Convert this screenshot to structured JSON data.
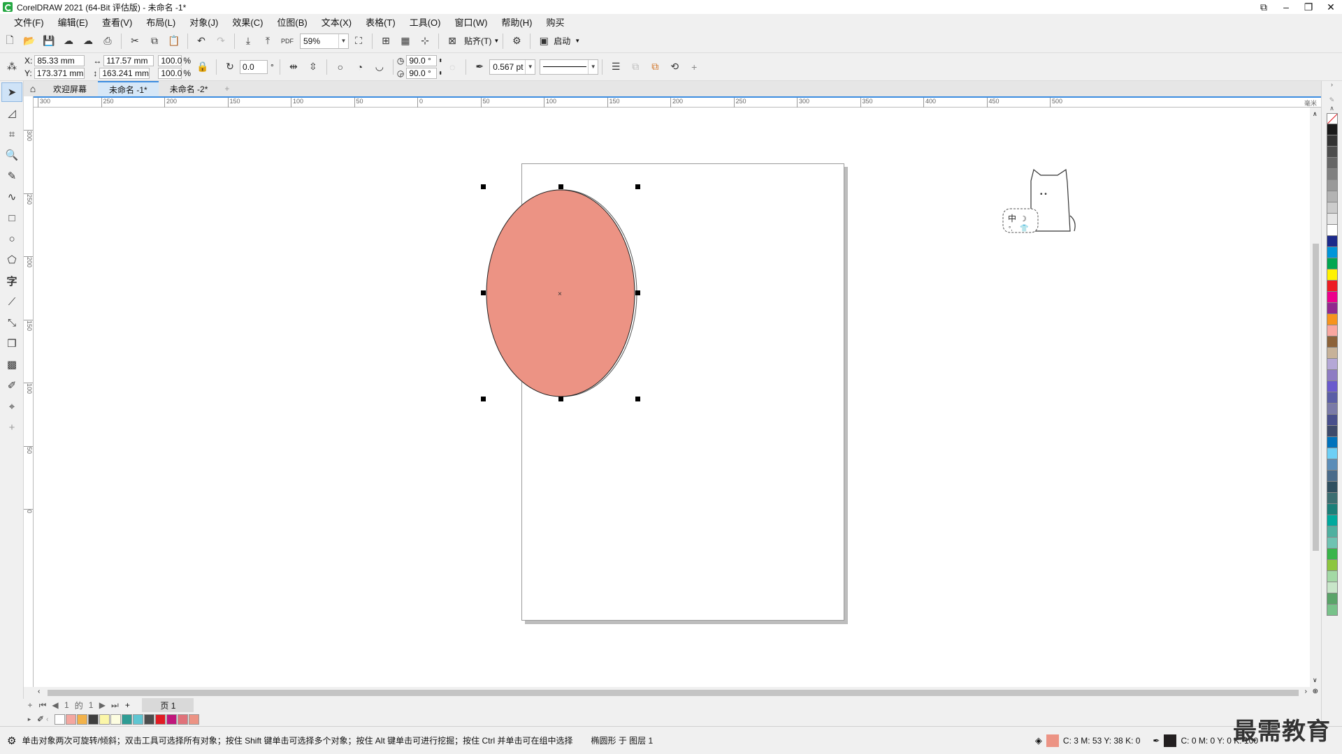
{
  "window": {
    "title": "CorelDRAW 2021 (64-Bit 评估版) - 未命名 -1*"
  },
  "menu": [
    "文件(F)",
    "编辑(E)",
    "查看(V)",
    "布局(L)",
    "对象(J)",
    "效果(C)",
    "位图(B)",
    "文本(X)",
    "表格(T)",
    "工具(O)",
    "窗口(W)",
    "帮助(H)",
    "购买"
  ],
  "toolbar": {
    "zoom": "59%",
    "snap_label": "贴齐(T)",
    "launch_label": "启动"
  },
  "props": {
    "x_label": "X:",
    "x": "85.33 mm",
    "y_label": "Y:",
    "y": "173.371 mm",
    "width": "117.57 mm",
    "height": "163.241 mm",
    "scale_x": "100.0",
    "scale_y": "100.0",
    "percent": "%",
    "rotation": "0.0",
    "degree_symbol": "°",
    "start_angle": "90.0 °",
    "end_angle": "90.0 °",
    "outline_width": "0.567 pt"
  },
  "tabs": [
    "欢迎屏幕",
    "未命名 -1*",
    "未命名 -2*"
  ],
  "ruler": {
    "h_ticks": [
      "300",
      "250",
      "200",
      "150",
      "100",
      "50",
      "0",
      "50",
      "100",
      "150",
      "200",
      "250",
      "300",
      "350",
      "400",
      "450",
      "500"
    ],
    "h_unit": "毫米",
    "v_ticks": [
      "300",
      "250",
      "200",
      "150",
      "100",
      "50",
      "0"
    ]
  },
  "pagenav": {
    "current": "1",
    "of": "的",
    "total": "1",
    "page_tab": "页 1"
  },
  "status": {
    "hint": "单击对象两次可旋转/倾斜；双击工具可选择所有对象；按住 Shift 键单击可选择多个对象；按住 Alt 键单击可进行挖掘；按住 Ctrl 并单击可在组中选择",
    "object_info": "椭圆形 于 图层 1",
    "fill_cmyk": "C: 3 M: 53 Y: 38 K: 0",
    "outline_cmyk": "C: 0 M: 0 Y: 0 K: 100"
  },
  "ime": {
    "label": "中"
  },
  "watermark": "最需教育",
  "colors": {
    "ellipse_fill": "#ec9384",
    "accent": "#3c8de0",
    "doc_palette": [
      "#ffffff",
      "#f4a7a0",
      "#f2b24a",
      "#3f3f3f",
      "#fbf6a8",
      "#fdfde0",
      "#2e9c94",
      "#5fc6d2",
      "#4d4d4d",
      "#e11b23",
      "#c0177c",
      "#e0727a",
      "#ec9384"
    ],
    "right_palette": [
      "#1a1a1a",
      "#333333",
      "#4d4d4d",
      "#666666",
      "#808080",
      "#999999",
      "#b3b3b3",
      "#cccccc",
      "#e6e6e6",
      "#ffffff",
      "#1c2a8a",
      "#0095d9",
      "#00a651",
      "#fff200",
      "#ed1c24",
      "#ec008c",
      "#92278f",
      "#f7941d",
      "#f9a7a0",
      "#8c6239",
      "#c7b299",
      "#b4a7d6",
      "#8e7cc3",
      "#6a5acd",
      "#5b5ea6",
      "#7a7aa8",
      "#484f8c",
      "#3d4a6b",
      "#0072bc",
      "#6dcff6",
      "#5b8db8",
      "#4a6b8a",
      "#2f4f5f",
      "#3c6e71",
      "#1b7f79",
      "#00a99d",
      "#4fb0a0",
      "#6fc3b2",
      "#39b54a",
      "#8dc63f",
      "#a3d9a5",
      "#c8e6c9",
      "#5aa469",
      "#78c28a"
    ]
  }
}
